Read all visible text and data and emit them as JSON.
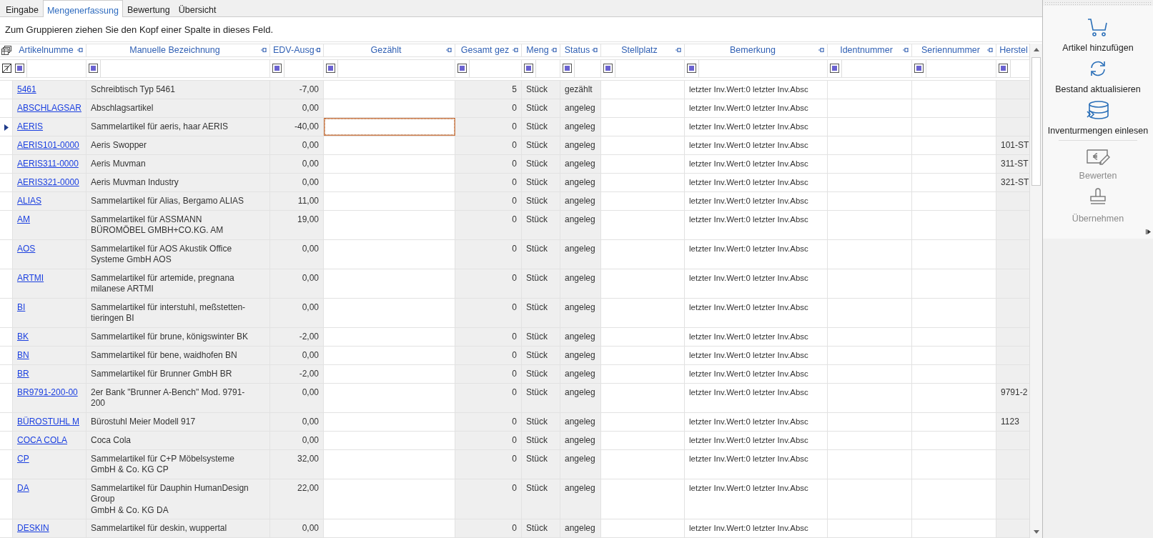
{
  "tabs": [
    {
      "label": "Eingabe",
      "selected": false
    },
    {
      "label": "Mengenerfassung",
      "selected": true
    },
    {
      "label": "Bewertung",
      "selected": false
    },
    {
      "label": "Übersicht",
      "selected": false
    }
  ],
  "group_panel": {
    "hint": "Zum Gruppieren ziehen Sie den Kopf einer Spalte in dieses Feld."
  },
  "grid": {
    "columns": [
      {
        "label": "Artikelnumme",
        "kind": "link",
        "editable": false
      },
      {
        "label": "Manuelle Bezeichnung",
        "kind": "text",
        "editable": false
      },
      {
        "label": "EDV-Ausg",
        "kind": "number",
        "editable": false
      },
      {
        "label": "Gezählt",
        "kind": "number",
        "editable": true
      },
      {
        "label": "Gesamt gez",
        "kind": "number",
        "editable": false
      },
      {
        "label": "Meng",
        "kind": "text",
        "editable": false
      },
      {
        "label": "Status",
        "kind": "text",
        "editable": false
      },
      {
        "label": "Stellplatz",
        "kind": "text",
        "editable": true
      },
      {
        "label": "Bemerkung",
        "kind": "text",
        "editable": true
      },
      {
        "label": "Identnummer",
        "kind": "text",
        "editable": true
      },
      {
        "label": "Seriennummer",
        "kind": "text",
        "editable": true
      },
      {
        "label": "Herstel",
        "kind": "text",
        "editable": false
      }
    ],
    "rows": [
      {
        "selected": false,
        "artikelnummer": "5461",
        "bezeichnung": "Schreibtisch Typ 5461",
        "edv_ausg": "-7,00",
        "gesamt_gez": "5",
        "menge": "Stück",
        "status": "gezählt",
        "bemerkung": "letzter Inv.Wert:0 letzter Inv.Absc"
      },
      {
        "selected": false,
        "artikelnummer": "ABSCHLAGSAR",
        "bezeichnung": "Abschlagsartikel",
        "edv_ausg": "0,00",
        "gesamt_gez": "0",
        "menge": "Stück",
        "status": "angeleg",
        "bemerkung": "letzter Inv.Wert:0 letzter Inv.Absc"
      },
      {
        "selected": true,
        "artikelnummer": "AERIS",
        "bezeichnung": "Sammelartikel für aeris, haar AERIS",
        "edv_ausg": "-40,00",
        "gesamt_gez": "0",
        "menge": "Stück",
        "status": "angeleg",
        "bemerkung": "letzter Inv.Wert:0 letzter Inv.Absc"
      },
      {
        "selected": false,
        "artikelnummer": "AERIS101-0000",
        "bezeichnung": "Aeris Swopper",
        "edv_ausg": "0,00",
        "gesamt_gez": "0",
        "menge": "Stück",
        "status": "angeleg",
        "bemerkung": "letzter Inv.Wert:0 letzter Inv.Absc",
        "hersteller": "101-ST"
      },
      {
        "selected": false,
        "artikelnummer": "AERIS311-0000",
        "bezeichnung": "Aeris Muvman",
        "edv_ausg": "0,00",
        "gesamt_gez": "0",
        "menge": "Stück",
        "status": "angeleg",
        "bemerkung": "letzter Inv.Wert:0 letzter Inv.Absc",
        "hersteller": "311-ST"
      },
      {
        "selected": false,
        "artikelnummer": "AERIS321-0000",
        "bezeichnung": "Aeris Muvman Industry",
        "edv_ausg": "0,00",
        "gesamt_gez": "0",
        "menge": "Stück",
        "status": "angeleg",
        "bemerkung": "letzter Inv.Wert:0 letzter Inv.Absc",
        "hersteller": "321-ST"
      },
      {
        "selected": false,
        "artikelnummer": "ALIAS",
        "bezeichnung": "Sammelartikel für Alias, Bergamo ALIAS",
        "edv_ausg": "11,00",
        "gesamt_gez": "0",
        "menge": "Stück",
        "status": "angeleg",
        "bemerkung": "letzter Inv.Wert:0 letzter Inv.Absc"
      },
      {
        "selected": false,
        "artikelnummer": "AM",
        "bezeichnung": "Sammelartikel für ASSMANN\nBÜROMÖBEL GMBH+CO.KG. AM",
        "edv_ausg": "19,00",
        "gesamt_gez": "0",
        "menge": "Stück",
        "status": "angeleg",
        "bemerkung": "letzter Inv.Wert:0 letzter Inv.Absc"
      },
      {
        "selected": false,
        "artikelnummer": "AOS",
        "bezeichnung": "Sammelartikel für AOS Akustik Office\nSysteme GmbH AOS",
        "edv_ausg": "0,00",
        "gesamt_gez": "0",
        "menge": "Stück",
        "status": "angeleg",
        "bemerkung": "letzter Inv.Wert:0 letzter Inv.Absc"
      },
      {
        "selected": false,
        "artikelnummer": "ARTMI",
        "bezeichnung": "Sammelartikel für artemide, pregnana\nmilanese ARTMI",
        "edv_ausg": "0,00",
        "gesamt_gez": "0",
        "menge": "Stück",
        "status": "angeleg",
        "bemerkung": "letzter Inv.Wert:0 letzter Inv.Absc"
      },
      {
        "selected": false,
        "artikelnummer": "BI",
        "bezeichnung": "Sammelartikel für interstuhl, meßstetten-\ntieringen BI",
        "edv_ausg": "0,00",
        "gesamt_gez": "0",
        "menge": "Stück",
        "status": "angeleg",
        "bemerkung": "letzter Inv.Wert:0 letzter Inv.Absc"
      },
      {
        "selected": false,
        "artikelnummer": "BK",
        "bezeichnung": "Sammelartikel für brune, königswinter BK",
        "edv_ausg": "-2,00",
        "gesamt_gez": "0",
        "menge": "Stück",
        "status": "angeleg",
        "bemerkung": "letzter Inv.Wert:0 letzter Inv.Absc"
      },
      {
        "selected": false,
        "artikelnummer": "BN",
        "bezeichnung": "Sammelartikel für bene, waidhofen BN",
        "edv_ausg": "0,00",
        "gesamt_gez": "0",
        "menge": "Stück",
        "status": "angeleg",
        "bemerkung": "letzter Inv.Wert:0 letzter Inv.Absc"
      },
      {
        "selected": false,
        "artikelnummer": "BR",
        "bezeichnung": "Sammelartikel für Brunner GmbH BR",
        "edv_ausg": "-2,00",
        "gesamt_gez": "0",
        "menge": "Stück",
        "status": "angeleg",
        "bemerkung": "letzter Inv.Wert:0 letzter Inv.Absc"
      },
      {
        "selected": false,
        "artikelnummer": "BR9791-200-00",
        "bezeichnung": "2er Bank \"Brunner A-Bench\" Mod. 9791-\n200",
        "edv_ausg": "0,00",
        "gesamt_gez": "0",
        "menge": "Stück",
        "status": "angeleg",
        "bemerkung": "letzter Inv.Wert:0 letzter Inv.Absc",
        "hersteller": "9791-2"
      },
      {
        "selected": false,
        "artikelnummer": "BÜROSTUHL M",
        "bezeichnung": "Bürostuhl Meier Modell 917",
        "edv_ausg": "0,00",
        "gesamt_gez": "0",
        "menge": "Stück",
        "status": "angeleg",
        "bemerkung": "letzter Inv.Wert:0 letzter Inv.Absc",
        "hersteller": "1123"
      },
      {
        "selected": false,
        "artikelnummer": "COCA COLA",
        "bezeichnung": "Coca Cola",
        "edv_ausg": "0,00",
        "gesamt_gez": "0",
        "menge": "Stück",
        "status": "angeleg",
        "bemerkung": "letzter Inv.Wert:0 letzter Inv.Absc"
      },
      {
        "selected": false,
        "artikelnummer": "CP",
        "bezeichnung": "Sammelartikel für C+P Möbelsysteme\nGmbH & Co. KG CP",
        "edv_ausg": "32,00",
        "gesamt_gez": "0",
        "menge": "Stück",
        "status": "angeleg",
        "bemerkung": "letzter Inv.Wert:0 letzter Inv.Absc"
      },
      {
        "selected": false,
        "artikelnummer": "DA",
        "bezeichnung": "Sammelartikel für Dauphin HumanDesign\nGroup\nGmbH & Co. KG DA",
        "edv_ausg": "22,00",
        "gesamt_gez": "0",
        "menge": "Stück",
        "status": "angeleg",
        "bemerkung": "letzter Inv.Wert:0 letzter Inv.Absc"
      },
      {
        "selected": false,
        "artikelnummer": "DESKIN",
        "bezeichnung": "Sammelartikel für deskin, wuppertal",
        "edv_ausg": "0,00",
        "gesamt_gez": "0",
        "menge": "Stück",
        "status": "angeleg",
        "bemerkung": "letzter Inv.Wert:0 letzter Inv.Absc"
      }
    ]
  },
  "actions": [
    {
      "label": "Artikel hinzufügen",
      "disabled": false
    },
    {
      "label": "Bestand aktualisieren",
      "disabled": false
    },
    {
      "label": "Inventurmengen einlesen",
      "disabled": false
    },
    {
      "label": "Bewerten",
      "disabled": true
    },
    {
      "label": "Übernehmen",
      "disabled": true
    }
  ]
}
